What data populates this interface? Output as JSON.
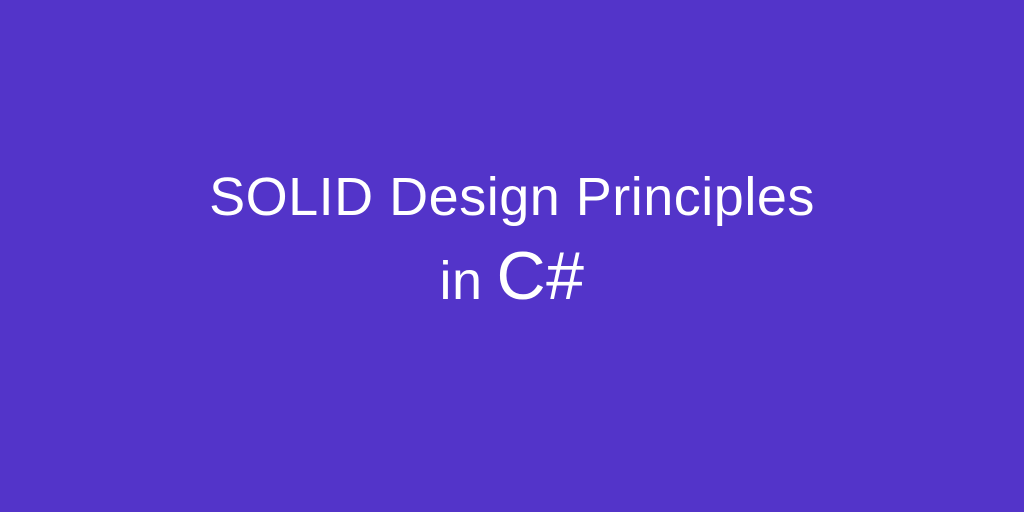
{
  "heading": {
    "line1": "SOLID Design Principles",
    "line2_prefix": "in",
    "line2_lang": "C#"
  },
  "colors": {
    "background": "#5334c9",
    "text": "#ffffff"
  }
}
